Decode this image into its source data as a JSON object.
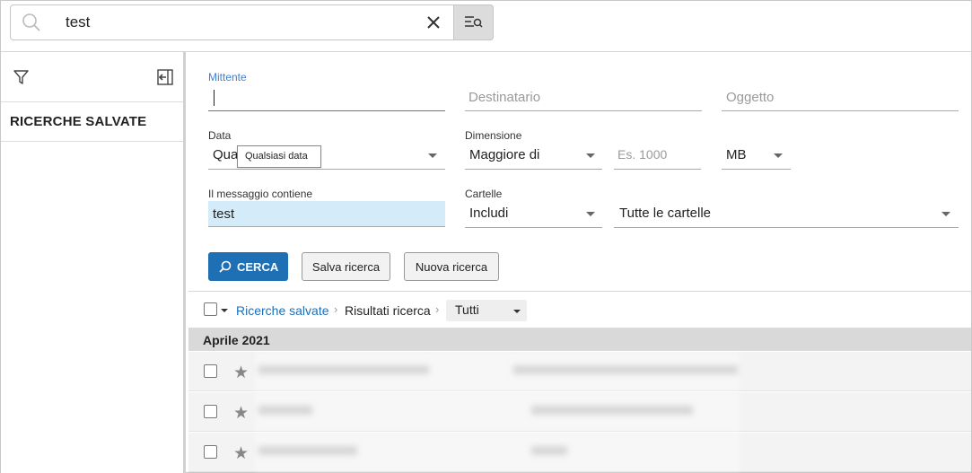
{
  "search": {
    "value": "test"
  },
  "sidebar": {
    "saved_label": "RICERCHE SALVATE"
  },
  "form": {
    "mittente_label": "Mittente",
    "destinatario_placeholder": "Destinatario",
    "oggetto_placeholder": "Oggetto",
    "data_label": "Data",
    "data_value": "Qua",
    "data_tooltip": "Qualsiasi data",
    "dimensione_label": "Dimensione",
    "dimensione_value": "Maggiore di",
    "size_placeholder": "Es. 1000",
    "unit_value": "MB",
    "messaggio_label": "Il messaggio contiene",
    "messaggio_value": "test",
    "cartelle_label": "Cartelle",
    "cartelle_value": "Includi",
    "folders_value": "Tutte le cartelle",
    "search_button": "CERCA",
    "save_button": "Salva ricerca",
    "new_button": "Nuova ricerca"
  },
  "results": {
    "crumb_saved": "Ricerche salvate",
    "crumb_results": "Risultati ricerca",
    "filter_value": "Tutti",
    "group_header": "Aprile 2021"
  },
  "colors": {
    "accent": "#1f6fb5",
    "focus_label": "#3d7fd6",
    "highlight": "#d4ebfa"
  },
  "icons": [
    "search-icon",
    "close-icon",
    "advanced-search-icon",
    "filter-icon",
    "collapse-sidebar-icon",
    "magnifier-icon",
    "star-icon",
    "chevron-down-icon"
  ]
}
